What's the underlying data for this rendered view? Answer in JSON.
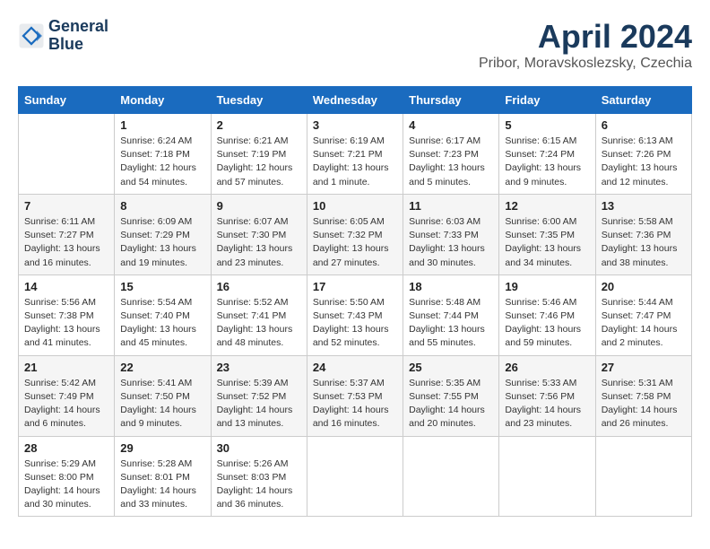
{
  "header": {
    "logo_line1": "General",
    "logo_line2": "Blue",
    "month_title": "April 2024",
    "location": "Pribor, Moravskoslezsky, Czechia"
  },
  "days_of_week": [
    "Sunday",
    "Monday",
    "Tuesday",
    "Wednesday",
    "Thursday",
    "Friday",
    "Saturday"
  ],
  "weeks": [
    [
      {
        "day": "",
        "info": ""
      },
      {
        "day": "1",
        "info": "Sunrise: 6:24 AM\nSunset: 7:18 PM\nDaylight: 12 hours\nand 54 minutes."
      },
      {
        "day": "2",
        "info": "Sunrise: 6:21 AM\nSunset: 7:19 PM\nDaylight: 12 hours\nand 57 minutes."
      },
      {
        "day": "3",
        "info": "Sunrise: 6:19 AM\nSunset: 7:21 PM\nDaylight: 13 hours\nand 1 minute."
      },
      {
        "day": "4",
        "info": "Sunrise: 6:17 AM\nSunset: 7:23 PM\nDaylight: 13 hours\nand 5 minutes."
      },
      {
        "day": "5",
        "info": "Sunrise: 6:15 AM\nSunset: 7:24 PM\nDaylight: 13 hours\nand 9 minutes."
      },
      {
        "day": "6",
        "info": "Sunrise: 6:13 AM\nSunset: 7:26 PM\nDaylight: 13 hours\nand 12 minutes."
      }
    ],
    [
      {
        "day": "7",
        "info": "Sunrise: 6:11 AM\nSunset: 7:27 PM\nDaylight: 13 hours\nand 16 minutes."
      },
      {
        "day": "8",
        "info": "Sunrise: 6:09 AM\nSunset: 7:29 PM\nDaylight: 13 hours\nand 19 minutes."
      },
      {
        "day": "9",
        "info": "Sunrise: 6:07 AM\nSunset: 7:30 PM\nDaylight: 13 hours\nand 23 minutes."
      },
      {
        "day": "10",
        "info": "Sunrise: 6:05 AM\nSunset: 7:32 PM\nDaylight: 13 hours\nand 27 minutes."
      },
      {
        "day": "11",
        "info": "Sunrise: 6:03 AM\nSunset: 7:33 PM\nDaylight: 13 hours\nand 30 minutes."
      },
      {
        "day": "12",
        "info": "Sunrise: 6:00 AM\nSunset: 7:35 PM\nDaylight: 13 hours\nand 34 minutes."
      },
      {
        "day": "13",
        "info": "Sunrise: 5:58 AM\nSunset: 7:36 PM\nDaylight: 13 hours\nand 38 minutes."
      }
    ],
    [
      {
        "day": "14",
        "info": "Sunrise: 5:56 AM\nSunset: 7:38 PM\nDaylight: 13 hours\nand 41 minutes."
      },
      {
        "day": "15",
        "info": "Sunrise: 5:54 AM\nSunset: 7:40 PM\nDaylight: 13 hours\nand 45 minutes."
      },
      {
        "day": "16",
        "info": "Sunrise: 5:52 AM\nSunset: 7:41 PM\nDaylight: 13 hours\nand 48 minutes."
      },
      {
        "day": "17",
        "info": "Sunrise: 5:50 AM\nSunset: 7:43 PM\nDaylight: 13 hours\nand 52 minutes."
      },
      {
        "day": "18",
        "info": "Sunrise: 5:48 AM\nSunset: 7:44 PM\nDaylight: 13 hours\nand 55 minutes."
      },
      {
        "day": "19",
        "info": "Sunrise: 5:46 AM\nSunset: 7:46 PM\nDaylight: 13 hours\nand 59 minutes."
      },
      {
        "day": "20",
        "info": "Sunrise: 5:44 AM\nSunset: 7:47 PM\nDaylight: 14 hours\nand 2 minutes."
      }
    ],
    [
      {
        "day": "21",
        "info": "Sunrise: 5:42 AM\nSunset: 7:49 PM\nDaylight: 14 hours\nand 6 minutes."
      },
      {
        "day": "22",
        "info": "Sunrise: 5:41 AM\nSunset: 7:50 PM\nDaylight: 14 hours\nand 9 minutes."
      },
      {
        "day": "23",
        "info": "Sunrise: 5:39 AM\nSunset: 7:52 PM\nDaylight: 14 hours\nand 13 minutes."
      },
      {
        "day": "24",
        "info": "Sunrise: 5:37 AM\nSunset: 7:53 PM\nDaylight: 14 hours\nand 16 minutes."
      },
      {
        "day": "25",
        "info": "Sunrise: 5:35 AM\nSunset: 7:55 PM\nDaylight: 14 hours\nand 20 minutes."
      },
      {
        "day": "26",
        "info": "Sunrise: 5:33 AM\nSunset: 7:56 PM\nDaylight: 14 hours\nand 23 minutes."
      },
      {
        "day": "27",
        "info": "Sunrise: 5:31 AM\nSunset: 7:58 PM\nDaylight: 14 hours\nand 26 minutes."
      }
    ],
    [
      {
        "day": "28",
        "info": "Sunrise: 5:29 AM\nSunset: 8:00 PM\nDaylight: 14 hours\nand 30 minutes."
      },
      {
        "day": "29",
        "info": "Sunrise: 5:28 AM\nSunset: 8:01 PM\nDaylight: 14 hours\nand 33 minutes."
      },
      {
        "day": "30",
        "info": "Sunrise: 5:26 AM\nSunset: 8:03 PM\nDaylight: 14 hours\nand 36 minutes."
      },
      {
        "day": "",
        "info": ""
      },
      {
        "day": "",
        "info": ""
      },
      {
        "day": "",
        "info": ""
      },
      {
        "day": "",
        "info": ""
      }
    ]
  ]
}
